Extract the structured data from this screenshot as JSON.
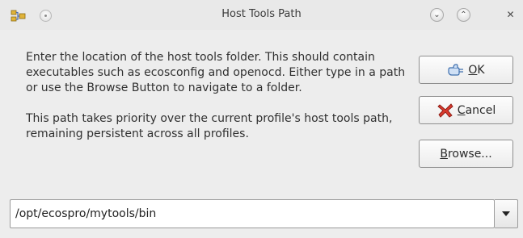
{
  "window": {
    "title": "Host Tools Path"
  },
  "titlebar_buttons": {
    "shade_glyph": "●",
    "minimize_glyph": "⌄",
    "maximize_glyph": "⌃",
    "close_glyph": "✕"
  },
  "description": {
    "paragraph1": "Enter the location of the host tools folder. This should contain executables such as ecosconfig and openocd. Either type in a path or use the Browse Button  to navigate to a folder.",
    "paragraph2": "This path takes priority over the current profile's host tools path, remaining persistent across all profiles."
  },
  "buttons": {
    "ok": {
      "mnemonic": "O",
      "rest": "K",
      "icon": "ok-hand-icon"
    },
    "cancel": {
      "mnemonic": "C",
      "rest": "ancel",
      "icon": "cancel-x-icon"
    },
    "browse": {
      "mnemonic": "B",
      "rest": "rowse...",
      "icon": "none"
    }
  },
  "path_field": {
    "value": "/opt/ecospro/mytools/bin"
  },
  "colors": {
    "window_bg": "#ededed",
    "cancel_icon_red": "#cc2222",
    "ok_icon_blue": "#5b8fd0"
  }
}
